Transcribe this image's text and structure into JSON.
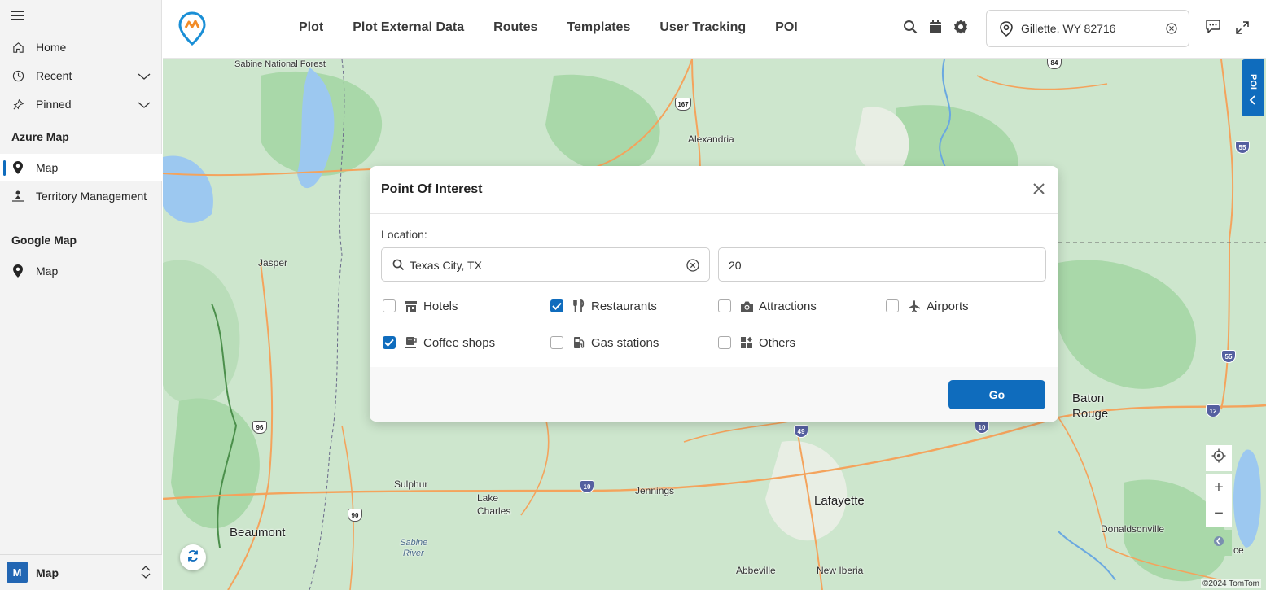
{
  "sidebar": {
    "items": [
      {
        "label": "Home",
        "icon": "home-icon"
      },
      {
        "label": "Recent",
        "icon": "clock-icon"
      },
      {
        "label": "Pinned",
        "icon": "pin-icon"
      }
    ],
    "sections": [
      {
        "title": "Azure Map",
        "items": [
          {
            "label": "Map",
            "active": true
          },
          {
            "label": "Territory Management"
          }
        ]
      },
      {
        "title": "Google Map",
        "items": [
          {
            "label": "Map"
          }
        ]
      }
    ],
    "bottom": {
      "badge": "M",
      "label": "Map"
    }
  },
  "header": {
    "menu": [
      "Plot",
      "Plot External Data",
      "Routes",
      "Templates",
      "User Tracking",
      "POI"
    ],
    "location": {
      "value": "Gillette, WY 82716"
    }
  },
  "map": {
    "poi_tab": "POI",
    "labels": {
      "sabine_forest": "Sabine National Forest",
      "alexandria": "Alexandria",
      "jasper": "Jasper",
      "baton_rouge_1": "Baton",
      "baton_rouge_2": "Rouge",
      "sulphur": "Sulphur",
      "lake_charles_1": "Lake",
      "lake_charles_2": "Charles",
      "jennings": "Jennings",
      "lafayette": "Lafayette",
      "beaumont": "Beaumont",
      "sabine_river_1": "Sabine",
      "sabine_river_2": "River",
      "abbeville": "Abbeville",
      "new_iberia": "New Iberia",
      "donaldsonville": "Donaldsonville",
      "place_partial": "ce"
    },
    "shields": {
      "s84": "84",
      "s167": "167",
      "s55a": "55",
      "s55b": "55",
      "s12": "12",
      "s10a": "10",
      "s49": "49",
      "s96": "96",
      "s10b": "10",
      "s90": "90"
    },
    "controls": {
      "zoom_in": "+",
      "zoom_out": "−"
    },
    "copyright": "©2024 TomTom"
  },
  "modal": {
    "title": "Point Of Interest",
    "location_label": "Location:",
    "location_value": "Texas City, TX",
    "radius_value": "20",
    "categories": [
      {
        "label": "Hotels",
        "checked": false,
        "icon": "store-icon"
      },
      {
        "label": "Restaurants",
        "checked": true,
        "icon": "utensils-icon"
      },
      {
        "label": "Attractions",
        "checked": false,
        "icon": "camera-icon"
      },
      {
        "label": "Airports",
        "checked": false,
        "icon": "plane-icon"
      },
      {
        "label": "Coffee shops",
        "checked": true,
        "icon": "coffee-icon"
      },
      {
        "label": "Gas stations",
        "checked": false,
        "icon": "gas-pump-icon"
      },
      {
        "label": "Others",
        "checked": false,
        "icon": "grid-icon"
      }
    ],
    "go_label": "Go"
  },
  "colors": {
    "accent": "#0f6cbd",
    "map_green": "#cfe8cf",
    "road": "#f5a35a"
  }
}
